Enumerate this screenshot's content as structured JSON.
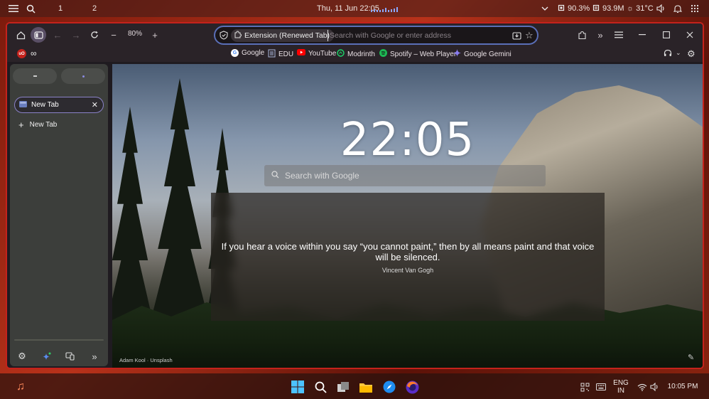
{
  "topbar": {
    "workspaces": [
      "1",
      "2"
    ],
    "datetime": "Thu, 11 Jun 22:05",
    "cpu": "90.3%",
    "memory": "93.9M",
    "weather": "31°C"
  },
  "toolbar": {
    "zoom": "80%",
    "extension_label": "Extension (Renewed Tab)",
    "url_placeholder": "Search with Google or enter address"
  },
  "bookmarks": [
    {
      "label": "Google",
      "icon": "google-icon",
      "color": "#4285f4"
    },
    {
      "label": "EDU",
      "icon": "document-icon",
      "color": "#7a90c8"
    },
    {
      "label": "YouTube",
      "icon": "youtube-icon",
      "color": "#ff0000"
    },
    {
      "label": "Modrinth",
      "icon": "modrinth-icon",
      "color": "#1bd96a"
    },
    {
      "label": "Spotify – Web Player",
      "icon": "spotify-icon",
      "color": "#1db954"
    },
    {
      "label": "Google Gemini",
      "icon": "gemini-icon",
      "color": "#8a7cf0"
    }
  ],
  "sidebar": {
    "active_tab": "New Tab",
    "new_tab_label": "New Tab"
  },
  "newtab": {
    "clock": "22:05",
    "search_placeholder": "Search with Google",
    "quote": "If you hear a voice within you say “you cannot paint,” then by all means paint and that voice will be silenced.",
    "quote_author": "Vincent Van Gogh",
    "photo_credit": "Adam Kool · Unsplash"
  },
  "taskbar": {
    "language": "ENG",
    "region": "IN",
    "time": "10:05 PM"
  },
  "colors": {
    "window_border": "#c4221c",
    "url_border": "#5a6fb8",
    "active_tab_border": "#8a82c8"
  }
}
